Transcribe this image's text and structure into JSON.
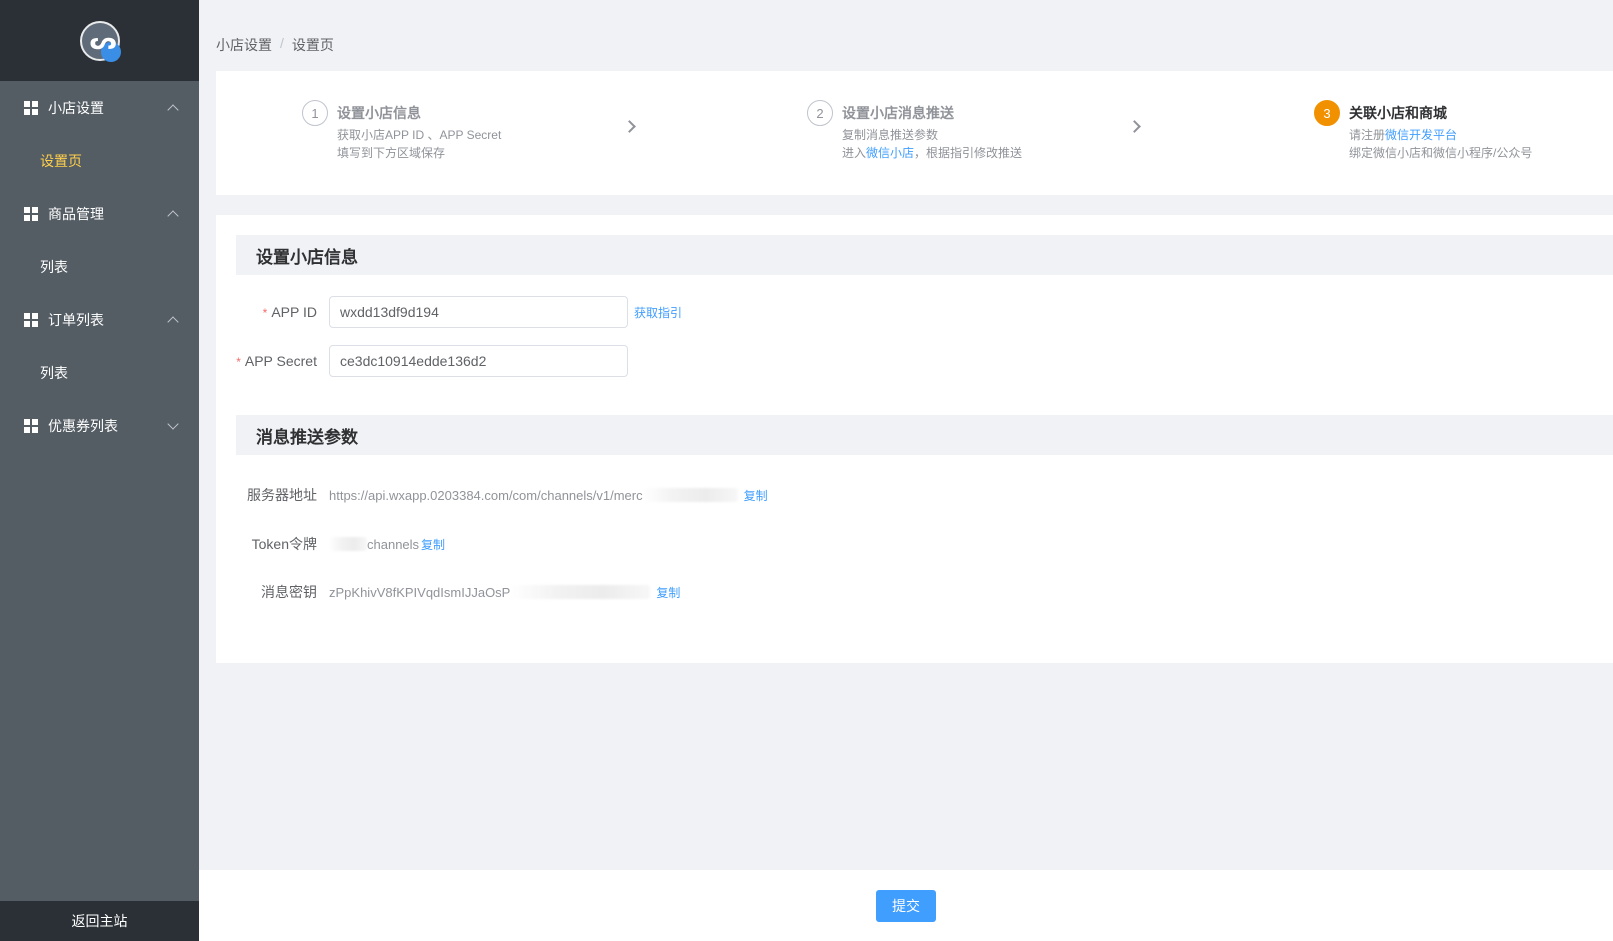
{
  "sidebar": {
    "back_home": "返回主站",
    "groups": [
      {
        "label": "小店设置",
        "expanded": true,
        "items": [
          {
            "label": "设置页",
            "active": true
          }
        ]
      },
      {
        "label": "商品管理",
        "expanded": true,
        "items": [
          {
            "label": "列表",
            "active": false
          }
        ]
      },
      {
        "label": "订单列表",
        "expanded": true,
        "items": [
          {
            "label": "列表",
            "active": false
          }
        ]
      },
      {
        "label": "优惠券列表",
        "expanded": false,
        "items": []
      }
    ]
  },
  "breadcrumb": {
    "parent": "小店设置",
    "separator": "/",
    "current": "设置页"
  },
  "steps": [
    {
      "num": "1",
      "title": "设置小店信息",
      "desc_line1": "获取小店APP ID 、APP Secret",
      "desc_line2": "填写到下方区域保存"
    },
    {
      "num": "2",
      "title": "设置小店消息推送",
      "desc_line1": "复制消息推送参数",
      "desc_line2_prefix": "进入",
      "desc_line2_link": "微信小店",
      "desc_line2_suffix": "，根据指引修改推送"
    },
    {
      "num": "3",
      "title": "关联小店和商城",
      "desc_line1_prefix": "请注册",
      "desc_line1_link": "微信开发平台",
      "desc_line2": "绑定微信小店和微信小程序/公众号",
      "active": true
    }
  ],
  "shop_info": {
    "section_title": "设置小店信息",
    "app_id_label": "APP ID",
    "app_id_value": "wxdd13df9d194",
    "app_id_guide": "获取指引",
    "app_secret_label": "APP Secret",
    "app_secret_value": "ce3dc10914edde136d2"
  },
  "push_params": {
    "section_title": "消息推送参数",
    "server_label": "服务器地址",
    "server_value": "https://api.wxapp.0203384.com/com/channels/v1/merc",
    "token_label": "Token令牌",
    "token_value": "channels",
    "key_label": "消息密钥",
    "key_value": "zPpKhivV8fKPIVqdIsmIJJaOsP",
    "copy_label": "复制"
  },
  "footer": {
    "submit": "提交"
  },
  "colors": {
    "accent": "#409eff",
    "active_menu": "#ffd04b",
    "step_active": "#f29100",
    "sidebar_bg": "#545c64"
  }
}
